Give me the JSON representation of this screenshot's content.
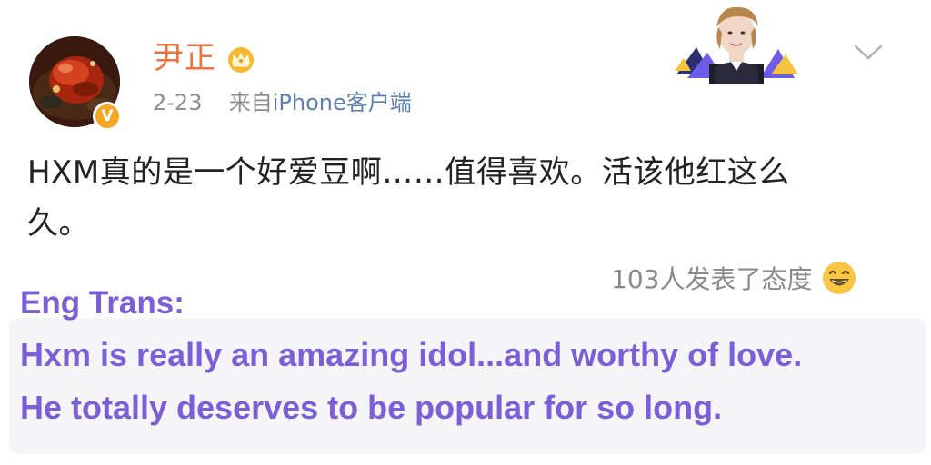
{
  "post": {
    "author": {
      "name": "尹正",
      "avatar_icon": "avatar-dish-photo",
      "verified_badge": "V",
      "member_badge_icon": "crown-icon"
    },
    "meta": {
      "date": "2-23",
      "source_prefix": "来自",
      "device": "iPhone客户端"
    },
    "text_line1": "HXM真的是一个好爱豆啊……值得喜欢。活该他红这么",
    "text_line2": "久。",
    "reactions": {
      "label": "103人发表了态度",
      "icon": "laugh-emoji-icon"
    },
    "more_icon": "chevron-down-icon"
  },
  "translation": {
    "heading": "Eng Trans:",
    "line1": "Hxm is really an amazing idol...and worthy of love.",
    "line2": "He totally deserves to be popular for so long."
  },
  "colors": {
    "name": "#eb7340",
    "meta": "#8e8e8e",
    "device": "#5b7fb0",
    "body": "#222222",
    "translation": "#7a5fd6",
    "translation_bg": "#f5f5f7"
  }
}
